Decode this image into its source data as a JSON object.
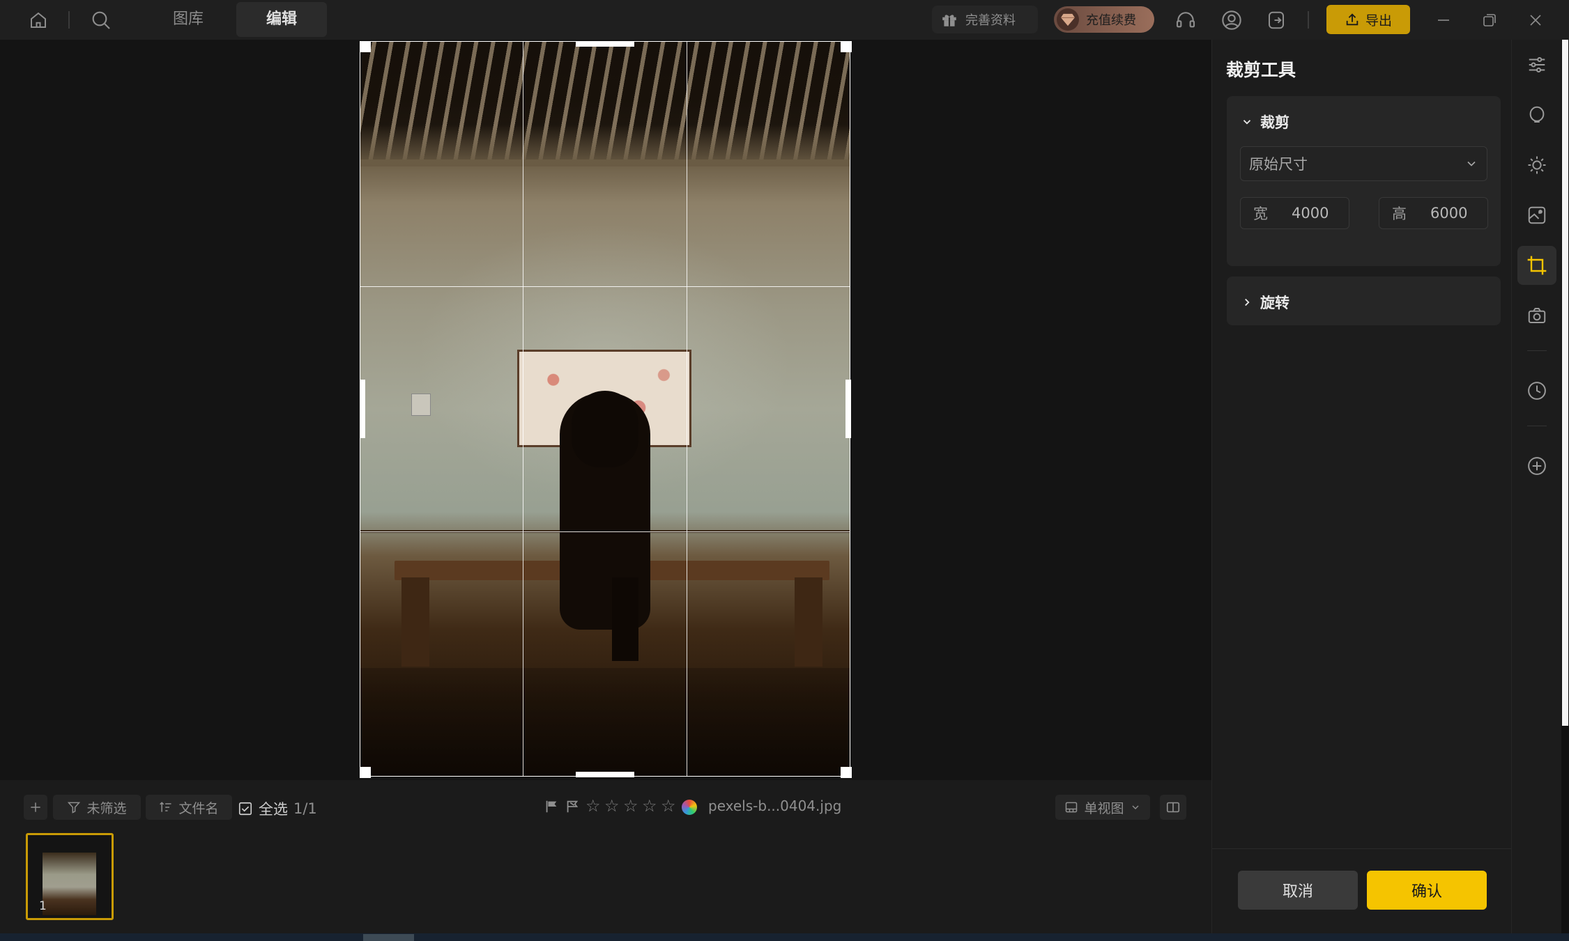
{
  "topbar": {
    "tabs": [
      {
        "label": "图库",
        "active": false
      },
      {
        "label": "编辑",
        "active": true
      }
    ],
    "gift_label": "完善资料",
    "vip_label": "充值续费",
    "export_label": "导出",
    "icons": [
      "home-icon",
      "search-icon",
      "headset-icon",
      "user-icon",
      "logout-icon",
      "minimize-icon",
      "restore-icon",
      "close-icon"
    ]
  },
  "strip": {
    "filter_label": "未筛选",
    "sort_label": "文件名",
    "select_all_label": "全选",
    "count": "1/1",
    "filename": "pexels-b...0404.jpg",
    "view_label": "单视图",
    "rating_stars": 5,
    "thumbnail_number": "1"
  },
  "panel": {
    "title": "裁剪工具",
    "crop_section": {
      "title": "裁剪",
      "expanded": true,
      "ratio_value": "原始尺寸",
      "width_label": "宽",
      "width_value": "4000",
      "height_label": "高",
      "height_value": "6000"
    },
    "rotate_section": {
      "title": "旋转",
      "expanded": false
    },
    "cancel_label": "取消",
    "confirm_label": "确认"
  },
  "rail": {
    "icons": [
      "sliders-icon",
      "ellipse-icon",
      "sun-icon",
      "image-edit-icon",
      "crop-icon",
      "camera-icon",
      "history-icon",
      "add-circle-icon"
    ],
    "active": "crop-icon"
  },
  "colors": {
    "accent": "#c99b06",
    "confirm": "#f5c400",
    "background": "#141414",
    "panel": "#1c1c1c"
  }
}
